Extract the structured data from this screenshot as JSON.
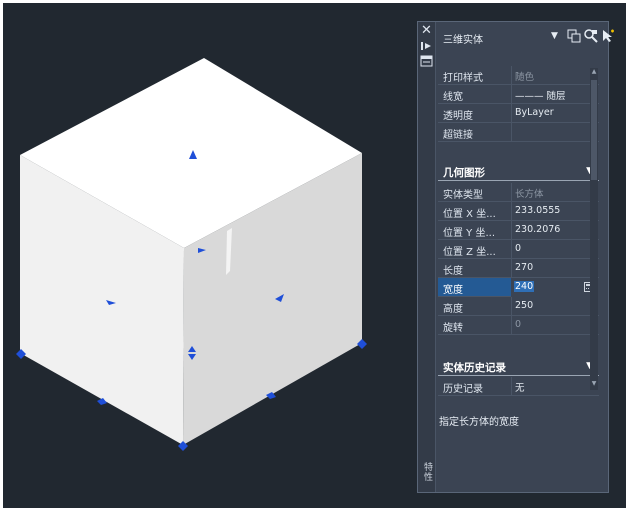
{
  "panel": {
    "strip": {
      "close_glyph": "✕",
      "title": "特性"
    },
    "header": {
      "object_type": "三维实体",
      "dropdown_glyph": "▼"
    },
    "icons": [
      "select-objects-icon",
      "quick-select-icon",
      "pickadd-toggle-icon",
      "auto-hide-icon",
      "properties-menu-icon"
    ],
    "rows_general": [
      {
        "label": "打印样式",
        "value": "随色",
        "dim": true
      },
      {
        "label": "线宽",
        "value": "——— 随层",
        "dim": false
      },
      {
        "label": "透明度",
        "value": "ByLayer",
        "dim": false
      },
      {
        "label": "超链接",
        "value": "",
        "dim": false
      }
    ],
    "section_geometry": {
      "title": "几何图形",
      "arrow": "▼"
    },
    "rows_geometry": [
      {
        "label": "实体类型",
        "value": "长方体",
        "dim": true
      },
      {
        "label": "位置 X 坐...",
        "value": "233.0555",
        "dim": false
      },
      {
        "label": "位置 Y 坐...",
        "value": "230.2076",
        "dim": false
      },
      {
        "label": "位置 Z 坐...",
        "value": "0",
        "dim": false
      },
      {
        "label": "长度",
        "value": "270",
        "dim": false
      },
      {
        "label": "宽度",
        "value": "240",
        "dim": false,
        "highlight": true
      },
      {
        "label": "高度",
        "value": "250",
        "dim": false
      },
      {
        "label": "旋转",
        "value": "0",
        "dim": true
      }
    ],
    "section_history": {
      "title": "实体历史记录",
      "arrow": "▼"
    },
    "rows_history": [
      {
        "label": "历史记录",
        "value": "无",
        "dim": false
      }
    ],
    "hint": "指定长方体的宽度"
  },
  "colors": {
    "background": "#212830",
    "panel": "#3b4453",
    "highlight": "#245a94",
    "grip": "#1f4fd8",
    "cube_top": "#ffffff",
    "cube_left": "#f1f1f1",
    "cube_right": "#d9d9d9"
  }
}
